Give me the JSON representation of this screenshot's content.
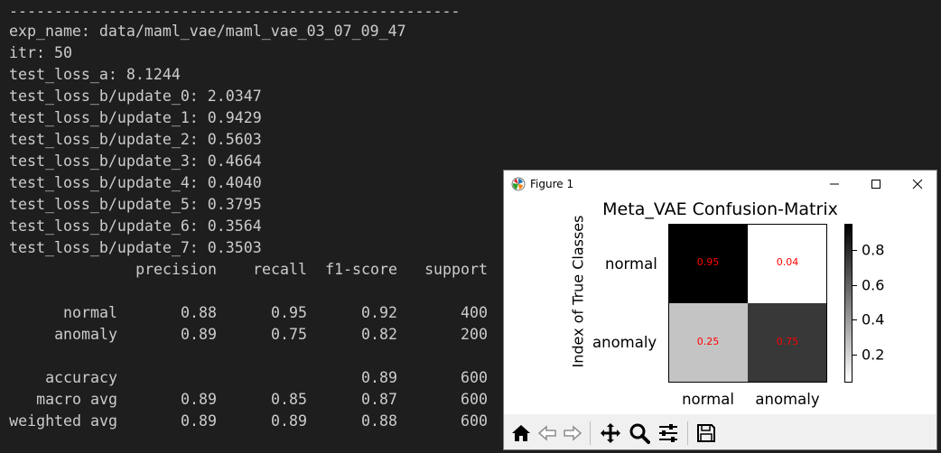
{
  "terminal": {
    "separator": "--------------------------------------------------",
    "exp_name": "exp_name: data/maml_vae/maml_vae_03_07_09_47",
    "itr": "itr: 50",
    "test_loss_a": "test_loss_a: 8.1244",
    "updates": [
      "test_loss_b/update_0: 2.0347",
      "test_loss_b/update_1: 0.9429",
      "test_loss_b/update_2: 0.5603",
      "test_loss_b/update_3: 0.4664",
      "test_loss_b/update_4: 0.4040",
      "test_loss_b/update_5: 0.3795",
      "test_loss_b/update_6: 0.3564",
      "test_loss_b/update_7: 0.3503"
    ],
    "report": {
      "headers": [
        "precision",
        "recall",
        "f1-score",
        "support"
      ],
      "rows": [
        {
          "label": "normal",
          "precision": "0.88",
          "recall": "0.95",
          "f1": "0.92",
          "support": "400"
        },
        {
          "label": "anomaly",
          "precision": "0.89",
          "recall": "0.75",
          "f1": "0.82",
          "support": "200"
        },
        {
          "label": "accuracy",
          "precision": "",
          "recall": "",
          "f1": "0.89",
          "support": "600"
        },
        {
          "label": "macro avg",
          "precision": "0.89",
          "recall": "0.85",
          "f1": "0.87",
          "support": "600"
        },
        {
          "label": "weighted avg",
          "precision": "0.89",
          "recall": "0.89",
          "f1": "0.88",
          "support": "600"
        }
      ]
    }
  },
  "figure_window": {
    "title": "Figure 1",
    "icons": {
      "app": "matplotlib-icon",
      "minimize": "minimize-icon",
      "maximize": "maximize-icon",
      "close": "close-icon"
    },
    "toolbar": [
      "home-icon",
      "back-icon",
      "forward-icon",
      "pan-icon",
      "zoom-icon",
      "subplots-icon",
      "save-icon"
    ]
  },
  "chart_data": {
    "type": "heatmap",
    "title": "Meta_VAE Confusion-Matrix",
    "ylabel": "Index of True Classes",
    "xlabel": "",
    "row_labels": [
      "normal",
      "anomaly"
    ],
    "col_labels": [
      "normal",
      "anomaly"
    ],
    "values": [
      [
        0.95,
        0.04
      ],
      [
        0.25,
        0.75
      ]
    ],
    "value_labels": [
      [
        "0.95",
        "0.04"
      ],
      [
        "0.25",
        "0.75"
      ]
    ],
    "colormap": "gray_r",
    "colorbar_range": [
      0.04,
      0.95
    ],
    "colorbar_ticks": [
      0.2,
      0.4,
      0.6,
      0.8
    ],
    "colorbar_tick_labels": [
      "0.2",
      "0.4",
      "0.6",
      "0.8"
    ],
    "annotation_color": "#ff0000"
  }
}
